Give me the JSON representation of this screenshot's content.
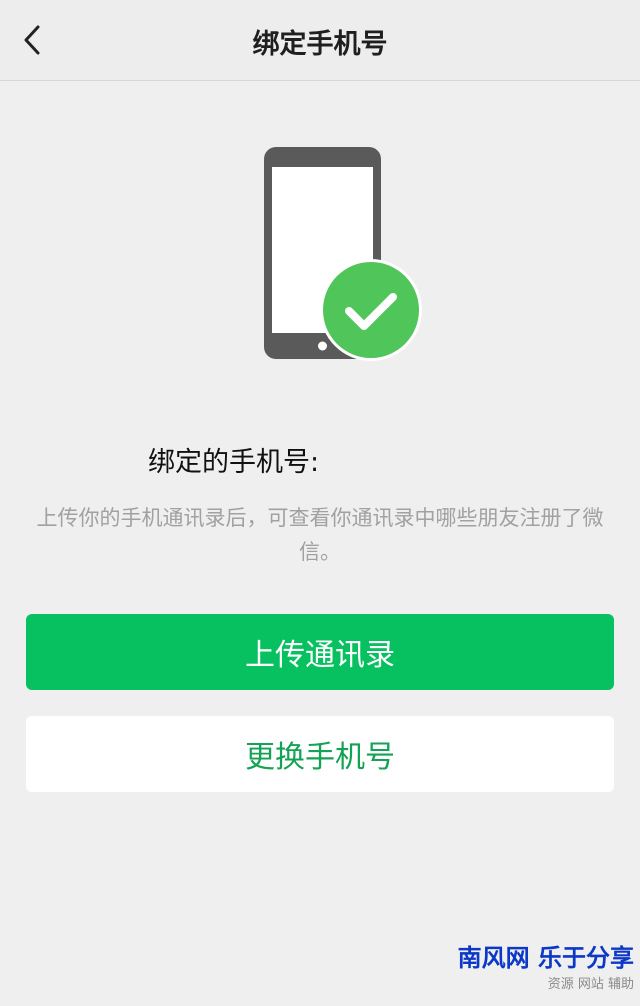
{
  "header": {
    "title": "绑定手机号",
    "back_icon": "chevron-left-icon"
  },
  "illustration": {
    "phone_icon": "smartphone-icon",
    "check_icon": "check-circle-icon",
    "check_color": "#4fc55a"
  },
  "content": {
    "bound_label": "绑定的手机号:",
    "description": "上传你的手机通讯录后，可查看你通讯录中哪些朋友注册了微信。"
  },
  "actions": {
    "upload_label": "上传通讯录",
    "change_label": "更换手机号"
  },
  "watermark": {
    "brand": "南风网 乐于分享",
    "sub": "资源 网站 辅助"
  },
  "colors": {
    "primary": "#07c160",
    "secondary_text": "#14a354",
    "background": "#efefef"
  }
}
